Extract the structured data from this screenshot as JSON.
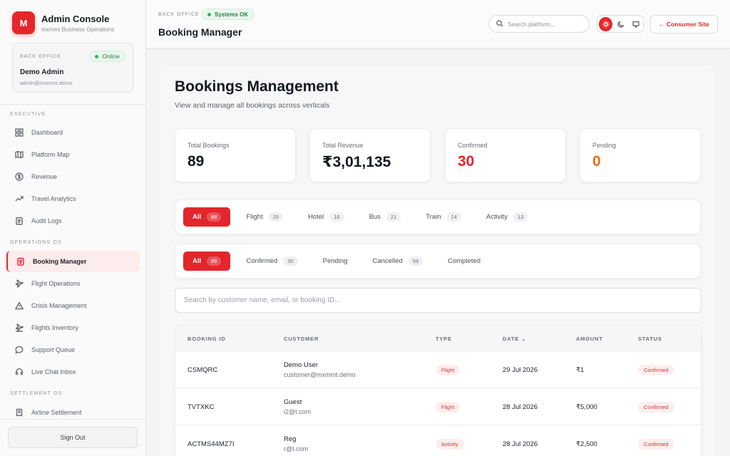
{
  "brand": {
    "logo_letter": "M",
    "title": "Admin Console",
    "subtitle": "mxmmt Business Operations"
  },
  "user_card": {
    "label": "BACK OFFICE",
    "status": "Online",
    "name": "Demo Admin",
    "email": "admin@mxmmt.demo"
  },
  "sidebar": {
    "sections": [
      "EXECUTIVE",
      "OPERATIONS OS",
      "SETTLEMENT OS"
    ],
    "executive": [
      {
        "label": "Dashboard",
        "icon": "grid-icon"
      },
      {
        "label": "Platform Map",
        "icon": "map-icon"
      },
      {
        "label": "Revenue",
        "icon": "dollar-icon"
      },
      {
        "label": "Travel Analytics",
        "icon": "trend-icon"
      },
      {
        "label": "Audit Logs",
        "icon": "clipboard-icon"
      }
    ],
    "operations": [
      {
        "label": "Booking Manager",
        "icon": "booking-icon"
      },
      {
        "label": "Flight Operations",
        "icon": "plane-icon"
      },
      {
        "label": "Crisis Management",
        "icon": "alert-icon"
      },
      {
        "label": "Flights Inventory",
        "icon": "plane-icon"
      },
      {
        "label": "Support Queue",
        "icon": "chat-icon"
      },
      {
        "label": "Live Chat Inbox",
        "icon": "headset-icon"
      }
    ],
    "settlement": [
      {
        "label": "Airline Settlement",
        "icon": "receipt-icon"
      }
    ],
    "sign_out": "Sign Out"
  },
  "header": {
    "label": "BACK OFFICE",
    "system_status": "Systems OK",
    "title": "Booking Manager",
    "search_placeholder": "Search platform...",
    "consumer_site": "← Consumer Site"
  },
  "main": {
    "title": "Bookings Management",
    "subtitle": "View and manage all bookings across verticals",
    "stats": [
      {
        "label": "Total Bookings",
        "value": "89",
        "tone": "default"
      },
      {
        "label": "Total Revenue",
        "value": "₹3,01,135",
        "tone": "default"
      },
      {
        "label": "Confirmed",
        "value": "30",
        "tone": "red"
      },
      {
        "label": "Pending",
        "value": "0",
        "tone": "orange"
      }
    ],
    "vertical_tabs": [
      {
        "label": "All",
        "count": "89"
      },
      {
        "label": "Flight",
        "count": "25"
      },
      {
        "label": "Hotel",
        "count": "16"
      },
      {
        "label": "Bus",
        "count": "21"
      },
      {
        "label": "Train",
        "count": "14"
      },
      {
        "label": "Activity",
        "count": "13"
      }
    ],
    "status_tabs": [
      {
        "label": "All",
        "count": "89"
      },
      {
        "label": "Confirmed",
        "count": "30"
      },
      {
        "label": "Pending",
        "count": ""
      },
      {
        "label": "Cancelled",
        "count": "59"
      },
      {
        "label": "Completed",
        "count": ""
      }
    ],
    "search_placeholder": "Search by customer name, email, or booking ID...",
    "table": {
      "headers": [
        "BOOKING ID",
        "CUSTOMER",
        "TYPE",
        "DATE",
        "AMOUNT",
        "STATUS"
      ],
      "rows": [
        {
          "id": "CSMQRC",
          "name": "Demo User",
          "email": "customer@mxmmt.demo",
          "type": "Flight",
          "date": "29 Jul 2026",
          "amount": "₹1",
          "status": "Confirmed"
        },
        {
          "id": "TVTXKC",
          "name": "Guest",
          "email": "i2@t.com",
          "type": "Flight",
          "date": "28 Jul 2026",
          "amount": "₹5,000",
          "status": "Confirmed"
        },
        {
          "id": "ACTMS44MZ7I",
          "name": "Reg",
          "email": "r@t.com",
          "type": "Activity",
          "date": "28 Jul 2026",
          "amount": "₹2,500",
          "status": "Confirmed"
        }
      ]
    }
  },
  "colors": {
    "accent": "#e3262c",
    "success": "#2fb45c",
    "pending": "#ec6a1e"
  }
}
